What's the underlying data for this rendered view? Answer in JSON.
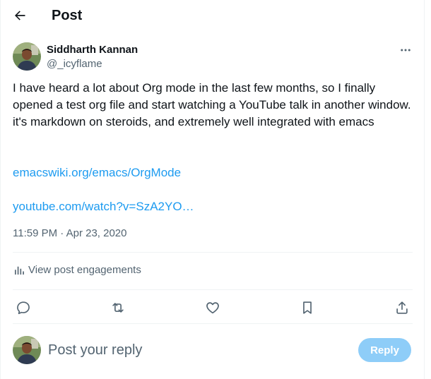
{
  "header": {
    "title": "Post"
  },
  "post": {
    "author_name": "Siddharth Kannan",
    "author_handle": "@_icyflame",
    "text": "I have heard a lot about Org mode in the last few months, so I finally opened a test org file and start watching a YouTube talk in another window. it's markdown on steroids, and extremely well integrated with emacs",
    "links": [
      "emacswiki.org/emacs/OrgMode",
      "youtube.com/watch?v=SzA2YO…"
    ],
    "timestamp": "11:59 PM · Apr 23, 2020",
    "engagements_label": "View post engagements"
  },
  "actions": [
    "reply-icon",
    "repost-icon",
    "like-icon",
    "bookmark-icon",
    "share-icon"
  ],
  "reply_box": {
    "placeholder": "Post your reply",
    "button_label": "Reply"
  },
  "colors": {
    "link": "#1d9bf0",
    "muted": "#536471",
    "reply_button": "#8ecdf8",
    "divider": "#eff3f4"
  }
}
